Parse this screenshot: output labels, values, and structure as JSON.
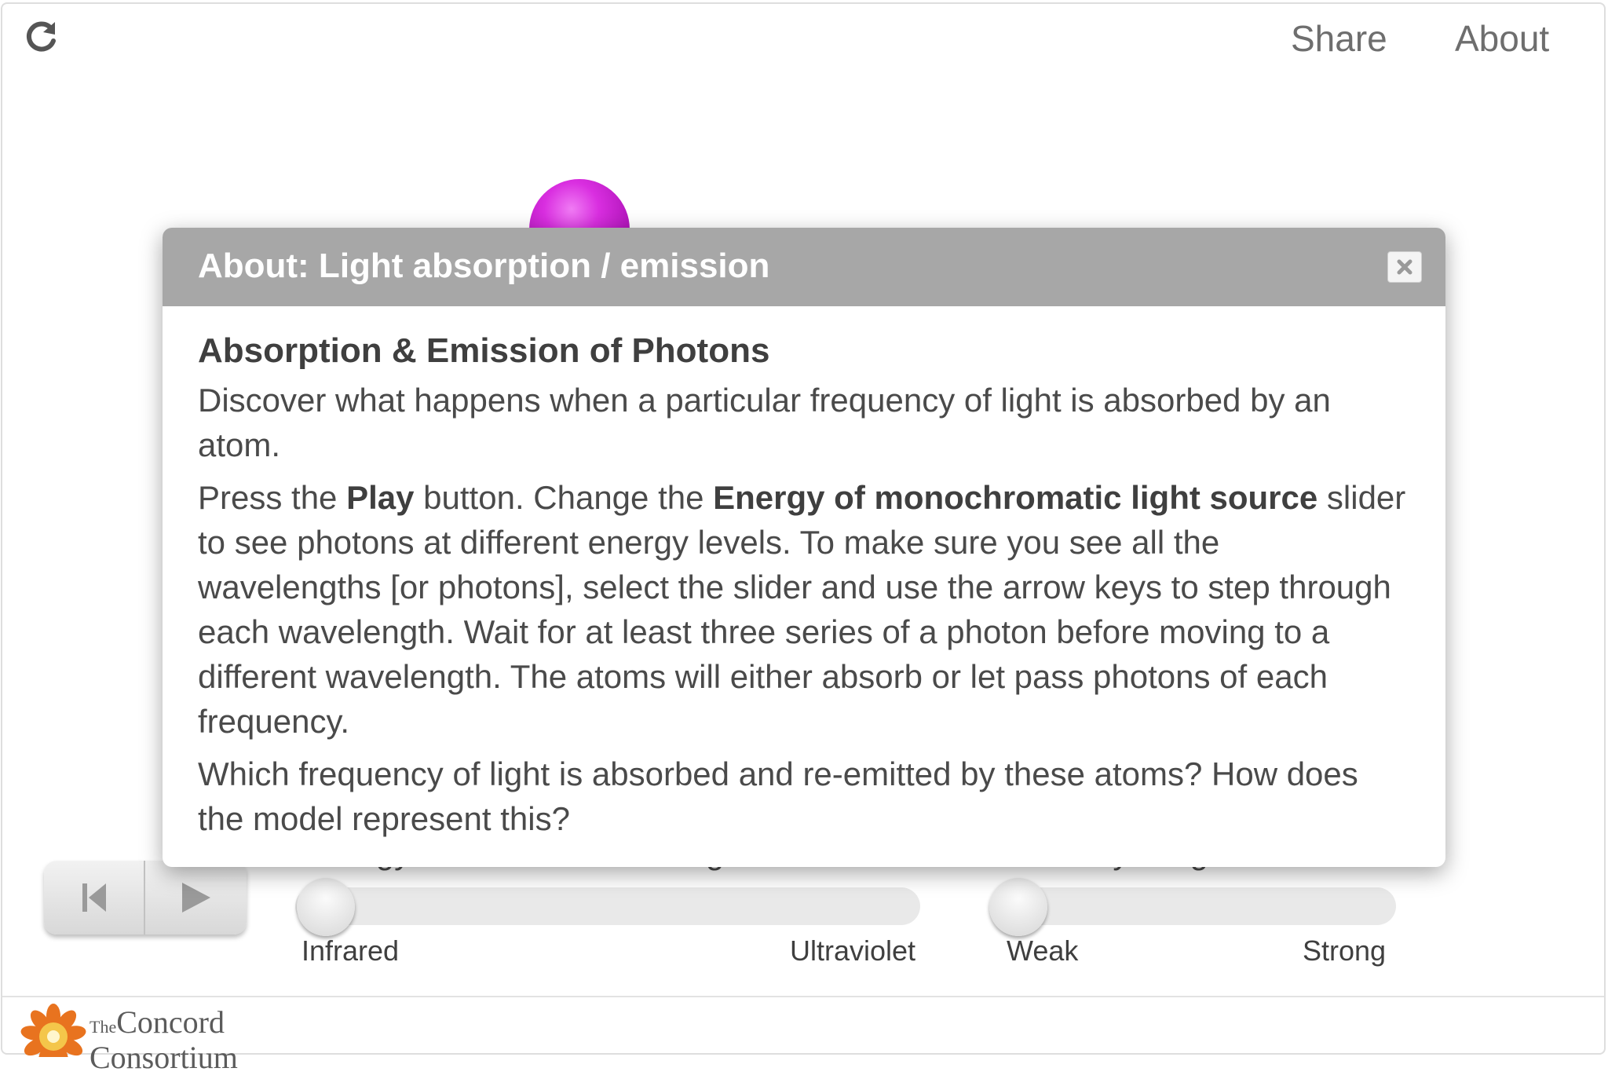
{
  "toolbar": {
    "reload_icon": "reload-icon",
    "share_label": "Share",
    "about_label": "About"
  },
  "model": {
    "atom_color": "#d92ee0"
  },
  "controls": {
    "energy_slider": {
      "label": "Energy of monochromatic light source",
      "min_label": "Infrared",
      "max_label": "Ultraviolet",
      "value": 0
    },
    "intensity_slider": {
      "label": "Intensity of light source",
      "min_label": "Weak",
      "max_label": "Strong",
      "value": 0
    },
    "reset_icon": "skip-back-icon",
    "play_icon": "play-icon"
  },
  "modal": {
    "title": "About: Light absorption / emission",
    "heading": "Absorption & Emission of Photons",
    "para1": "Discover what happens when a particular frequency of light is absorbed by an atom.",
    "para2_part1": "Press the ",
    "para2_bold1": "Play",
    "para2_part2": " button. Change the ",
    "para2_bold2": "Energy of monochromatic light source",
    "para2_part3": " slider to see photons at different energy levels. To make sure you see all the wavelengths [or photons], select the slider and use the arrow keys to step through each wavelength. Wait for at least three series of a photon before moving to a different wavelength. The atoms will either absorb or let pass photons of each frequency.",
    "para3": "Which frequency of light is absorbed and re-emitted by these atoms? How does the model represent this?",
    "close_icon": "close-icon"
  },
  "footer": {
    "logo_small": "The",
    "logo_line1": "Concord",
    "logo_line2": "Consortium",
    "logo_colors": [
      "#e8731f",
      "#f4c64a"
    ]
  }
}
